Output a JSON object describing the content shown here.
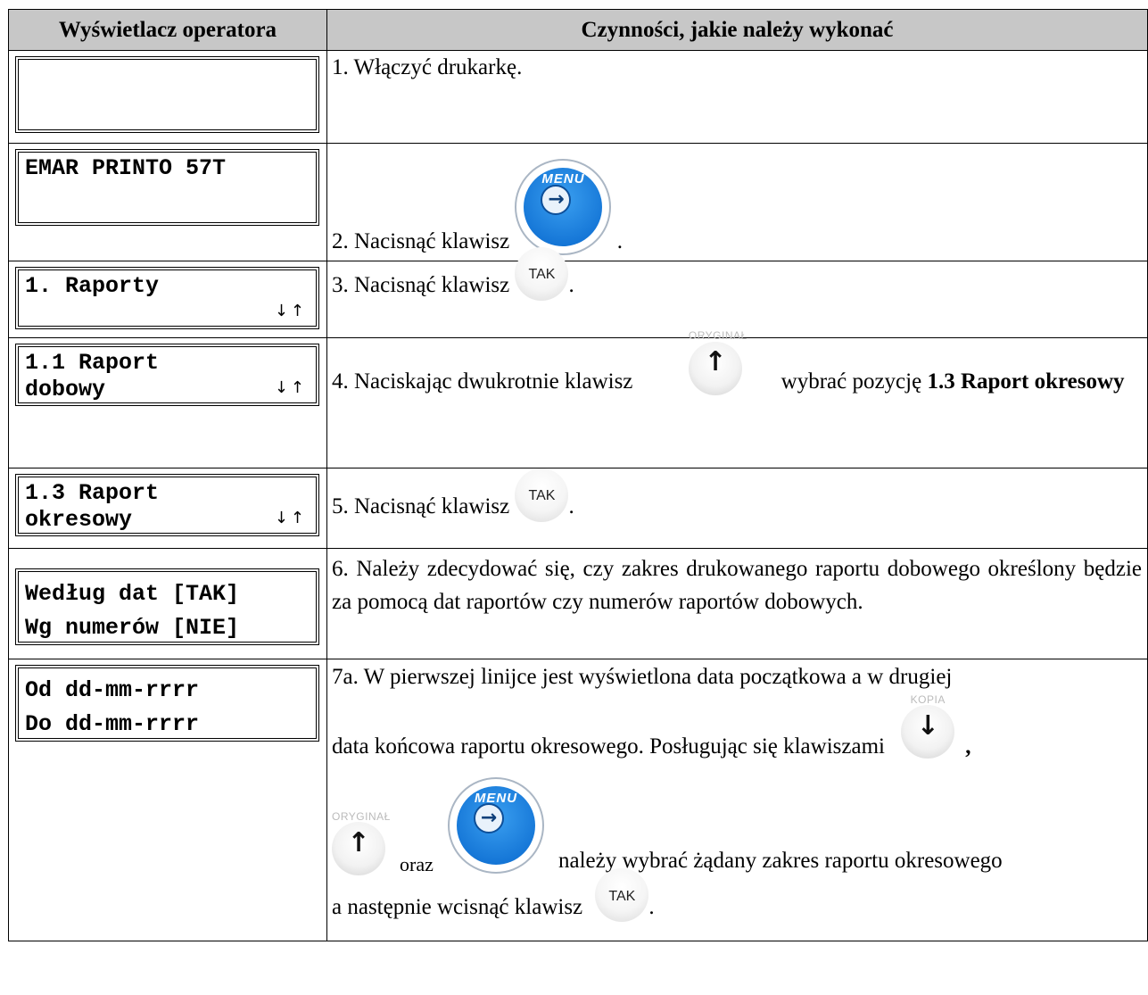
{
  "header": {
    "col1": "Wyświetlacz operatora",
    "col2": "Czynności, jakie należy wykonać"
  },
  "keys": {
    "tak": "TAK",
    "menu": "MENU",
    "oryginal": "ORYGINAŁ",
    "kopia": "KOPIA"
  },
  "rows": [
    {
      "lcd_line1": "",
      "lcd_line2": "",
      "text": "1. Włączyć drukarkę."
    },
    {
      "lcd_line1": "EMAR PRINTO 57T",
      "lcd_line2": "",
      "text_before": "2. Nacisnąć klawisz",
      "text_after": "."
    },
    {
      "lcd_line1": "1. Raporty",
      "lcd_arrows": "↓↑",
      "text_before": "3. Nacisnąć klawisz",
      "text_after": "."
    },
    {
      "lcd_line1": "1.1 Raport",
      "lcd_line2": "dobowy",
      "lcd_arrows": "↓↑",
      "text_before": "4. Naciskając dwukrotnie klawisz",
      "text_middle": "wybrać pozycję",
      "text_bold": "1.3 Raport okresowy"
    },
    {
      "lcd_line1": "1.3 Raport",
      "lcd_line2": "okresowy",
      "lcd_arrows": "↓↑",
      "text_before": "5. Nacisnąć klawisz",
      "text_after": "."
    },
    {
      "lcd_line1": "Według dat [TAK]",
      "lcd_line2": "Wg numerów [NIE]",
      "text": "6. Należy zdecydować się, czy zakres drukowanego raportu dobowego określony będzie za pomocą dat raportów czy numerów raportów dobowych."
    },
    {
      "lcd_line1": "Od dd-mm-rrrr",
      "lcd_line2": "Do dd-mm-rrrr",
      "text_a": "7a. W pierwszej linijce jest wyświetlona data początkowa a w drugiej",
      "text_b": "data  końcowa raportu okresowego. Posługując się klawiszami",
      "text_comma": ",",
      "text_oraz": "oraz",
      "text_c": "należy wybrać żądany zakres raportu okresowego",
      "text_d": "a następnie wcisnąć klawisz",
      "text_end": "."
    }
  ]
}
